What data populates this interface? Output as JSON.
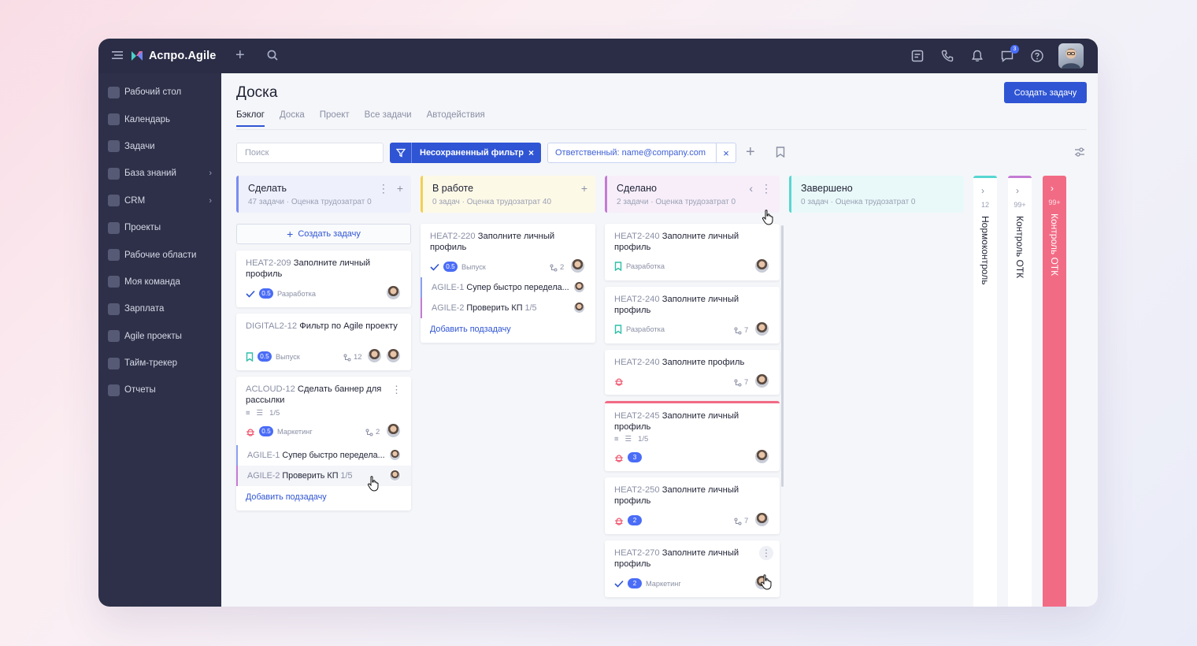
{
  "app": {
    "logo": "Аспро.Agile",
    "notif_count": "3"
  },
  "sidebar": {
    "items": [
      {
        "label": "Рабочий стол"
      },
      {
        "label": "Календарь"
      },
      {
        "label": "Задачи"
      },
      {
        "label": "База знаний",
        "chevron": true
      },
      {
        "label": "CRM",
        "chevron": true
      },
      {
        "label": "Проекты"
      },
      {
        "label": "Рабочие области"
      },
      {
        "label": "Моя команда"
      },
      {
        "label": "Зарплата"
      },
      {
        "label": "Agile проекты"
      },
      {
        "label": "Тайм-трекер"
      },
      {
        "label": "Отчеты"
      }
    ]
  },
  "page": {
    "title": "Доска",
    "create_button": "Создать задачу",
    "tabs": [
      "Бэклог",
      "Доска",
      "Проект",
      "Все задачи",
      "Автодействия"
    ]
  },
  "filters": {
    "search_placeholder": "Поиск",
    "active_filter": "Несохраненный фильтр",
    "chip": "Ответственный: name@company.com"
  },
  "columns": [
    {
      "title": "Сделать",
      "tasks": "47 задачи",
      "estimate": "Оценка трудозатрат 0",
      "color": "#7c8cf0",
      "bg": "#eef0fc"
    },
    {
      "title": "В работе",
      "tasks": "0 задач",
      "estimate": "Оценка трудозатрат 40",
      "color": "#f2cf55",
      "bg": "#fdf9e7"
    },
    {
      "title": "Сделано",
      "tasks": "2 задачи",
      "estimate": "Оценка трудозатрат 0",
      "color": "#c47bd4",
      "bg": "#f7eef9"
    },
    {
      "title": "Завершено",
      "tasks": "0 задач",
      "estimate": "Оценка трудозатрат 0",
      "color": "#57d6d2",
      "bg": "#e9f9f9"
    }
  ],
  "todo": {
    "create_task": "Создать задачу",
    "cards": [
      {
        "key": "HEAT2-209",
        "title": "Заполните личный профиль",
        "pill": "0.5",
        "tag": "Разработка"
      },
      {
        "key": "DIGITAL2-12",
        "title": "Фильтр по Agile проекту",
        "pill": "0.5",
        "tag": "Выпуск",
        "count": "12"
      },
      {
        "key": "ACLOUD-12",
        "title": "Сделать баннер для рассылки",
        "checklist": "1/5",
        "pill": "0.5",
        "tag": "Маркетинг",
        "count": "2",
        "subtasks": [
          {
            "key": "AGILE-1",
            "title": "Супер быстро передела..."
          },
          {
            "key": "AGILE-2",
            "title": "Проверить КП",
            "progress": "1/5"
          }
        ],
        "add_sub": "Добавить подзадачу"
      }
    ]
  },
  "inwork": {
    "card": {
      "key": "HEAT2-220",
      "title": "Заполните личный профиль",
      "pill": "0.5",
      "tag": "Выпуск",
      "count": "2",
      "subtasks": [
        {
          "key": "AGILE-1",
          "title": "Супер быстро передела..."
        },
        {
          "key": "AGILE-2",
          "title": "Проверить КП",
          "progress": "1/5"
        }
      ],
      "add_sub": "Добавить подзадачу"
    }
  },
  "done": {
    "cards": [
      {
        "key": "HEAT2-240",
        "title": "Заполните личный профиль",
        "tag": "Разработка"
      },
      {
        "key": "HEAT2-240",
        "title": "Заполните личный профиль",
        "tag": "Разработка",
        "count": "7"
      },
      {
        "key": "HEAT2-240",
        "title": "Заполните профиль",
        "count": "7"
      },
      {
        "key": "HEAT2-245",
        "title": "Заполните личный профиль",
        "checklist": "1/5",
        "pill": "3"
      },
      {
        "key": "HEAT2-250",
        "title": "Заполните личный профиль",
        "pill": "2",
        "count": "7"
      },
      {
        "key": "HEAT2-270",
        "title": "Заполните личный профиль",
        "pill": "2",
        "tag": "Маркетинг"
      }
    ]
  },
  "collapsed": [
    {
      "title": "Нормоконтроль",
      "count": "12",
      "color": "#57d6d2"
    },
    {
      "title": "Контроль ОТК",
      "count": "99+",
      "color": "#c47bd4"
    },
    {
      "title": "Контроль ОТК",
      "count": "99+",
      "color": "#f26b85"
    }
  ]
}
